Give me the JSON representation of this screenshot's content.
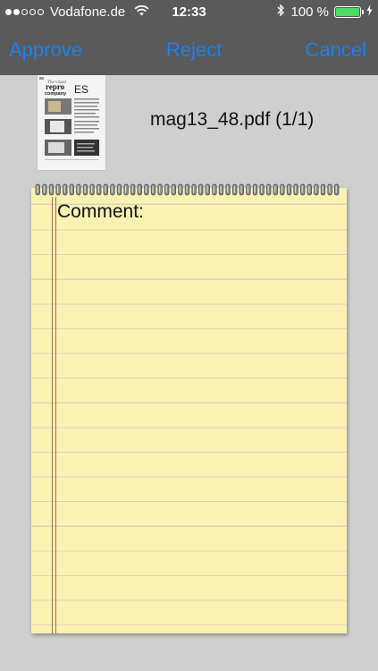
{
  "status_bar": {
    "carrier": "Vodafone.de",
    "time": "12:33",
    "battery_text": "100 %",
    "signal_strength": 2,
    "signal_max": 5,
    "battery_level": 1.0,
    "battery_color": "#4cd964"
  },
  "toolbar": {
    "approve_label": "Approve",
    "reject_label": "Reject",
    "cancel_label": "Cancel",
    "accent_color": "#1a82f2"
  },
  "document": {
    "filename": "mag13_48.pdf (1/1)",
    "thumbnail_icon": "pdf-page-thumbnail",
    "thumbnail_text": {
      "heading_1": "The visual",
      "heading_2": "repro",
      "heading_3": "company",
      "initials": "ES"
    }
  },
  "comment": {
    "label": "Comment:",
    "value": ""
  }
}
